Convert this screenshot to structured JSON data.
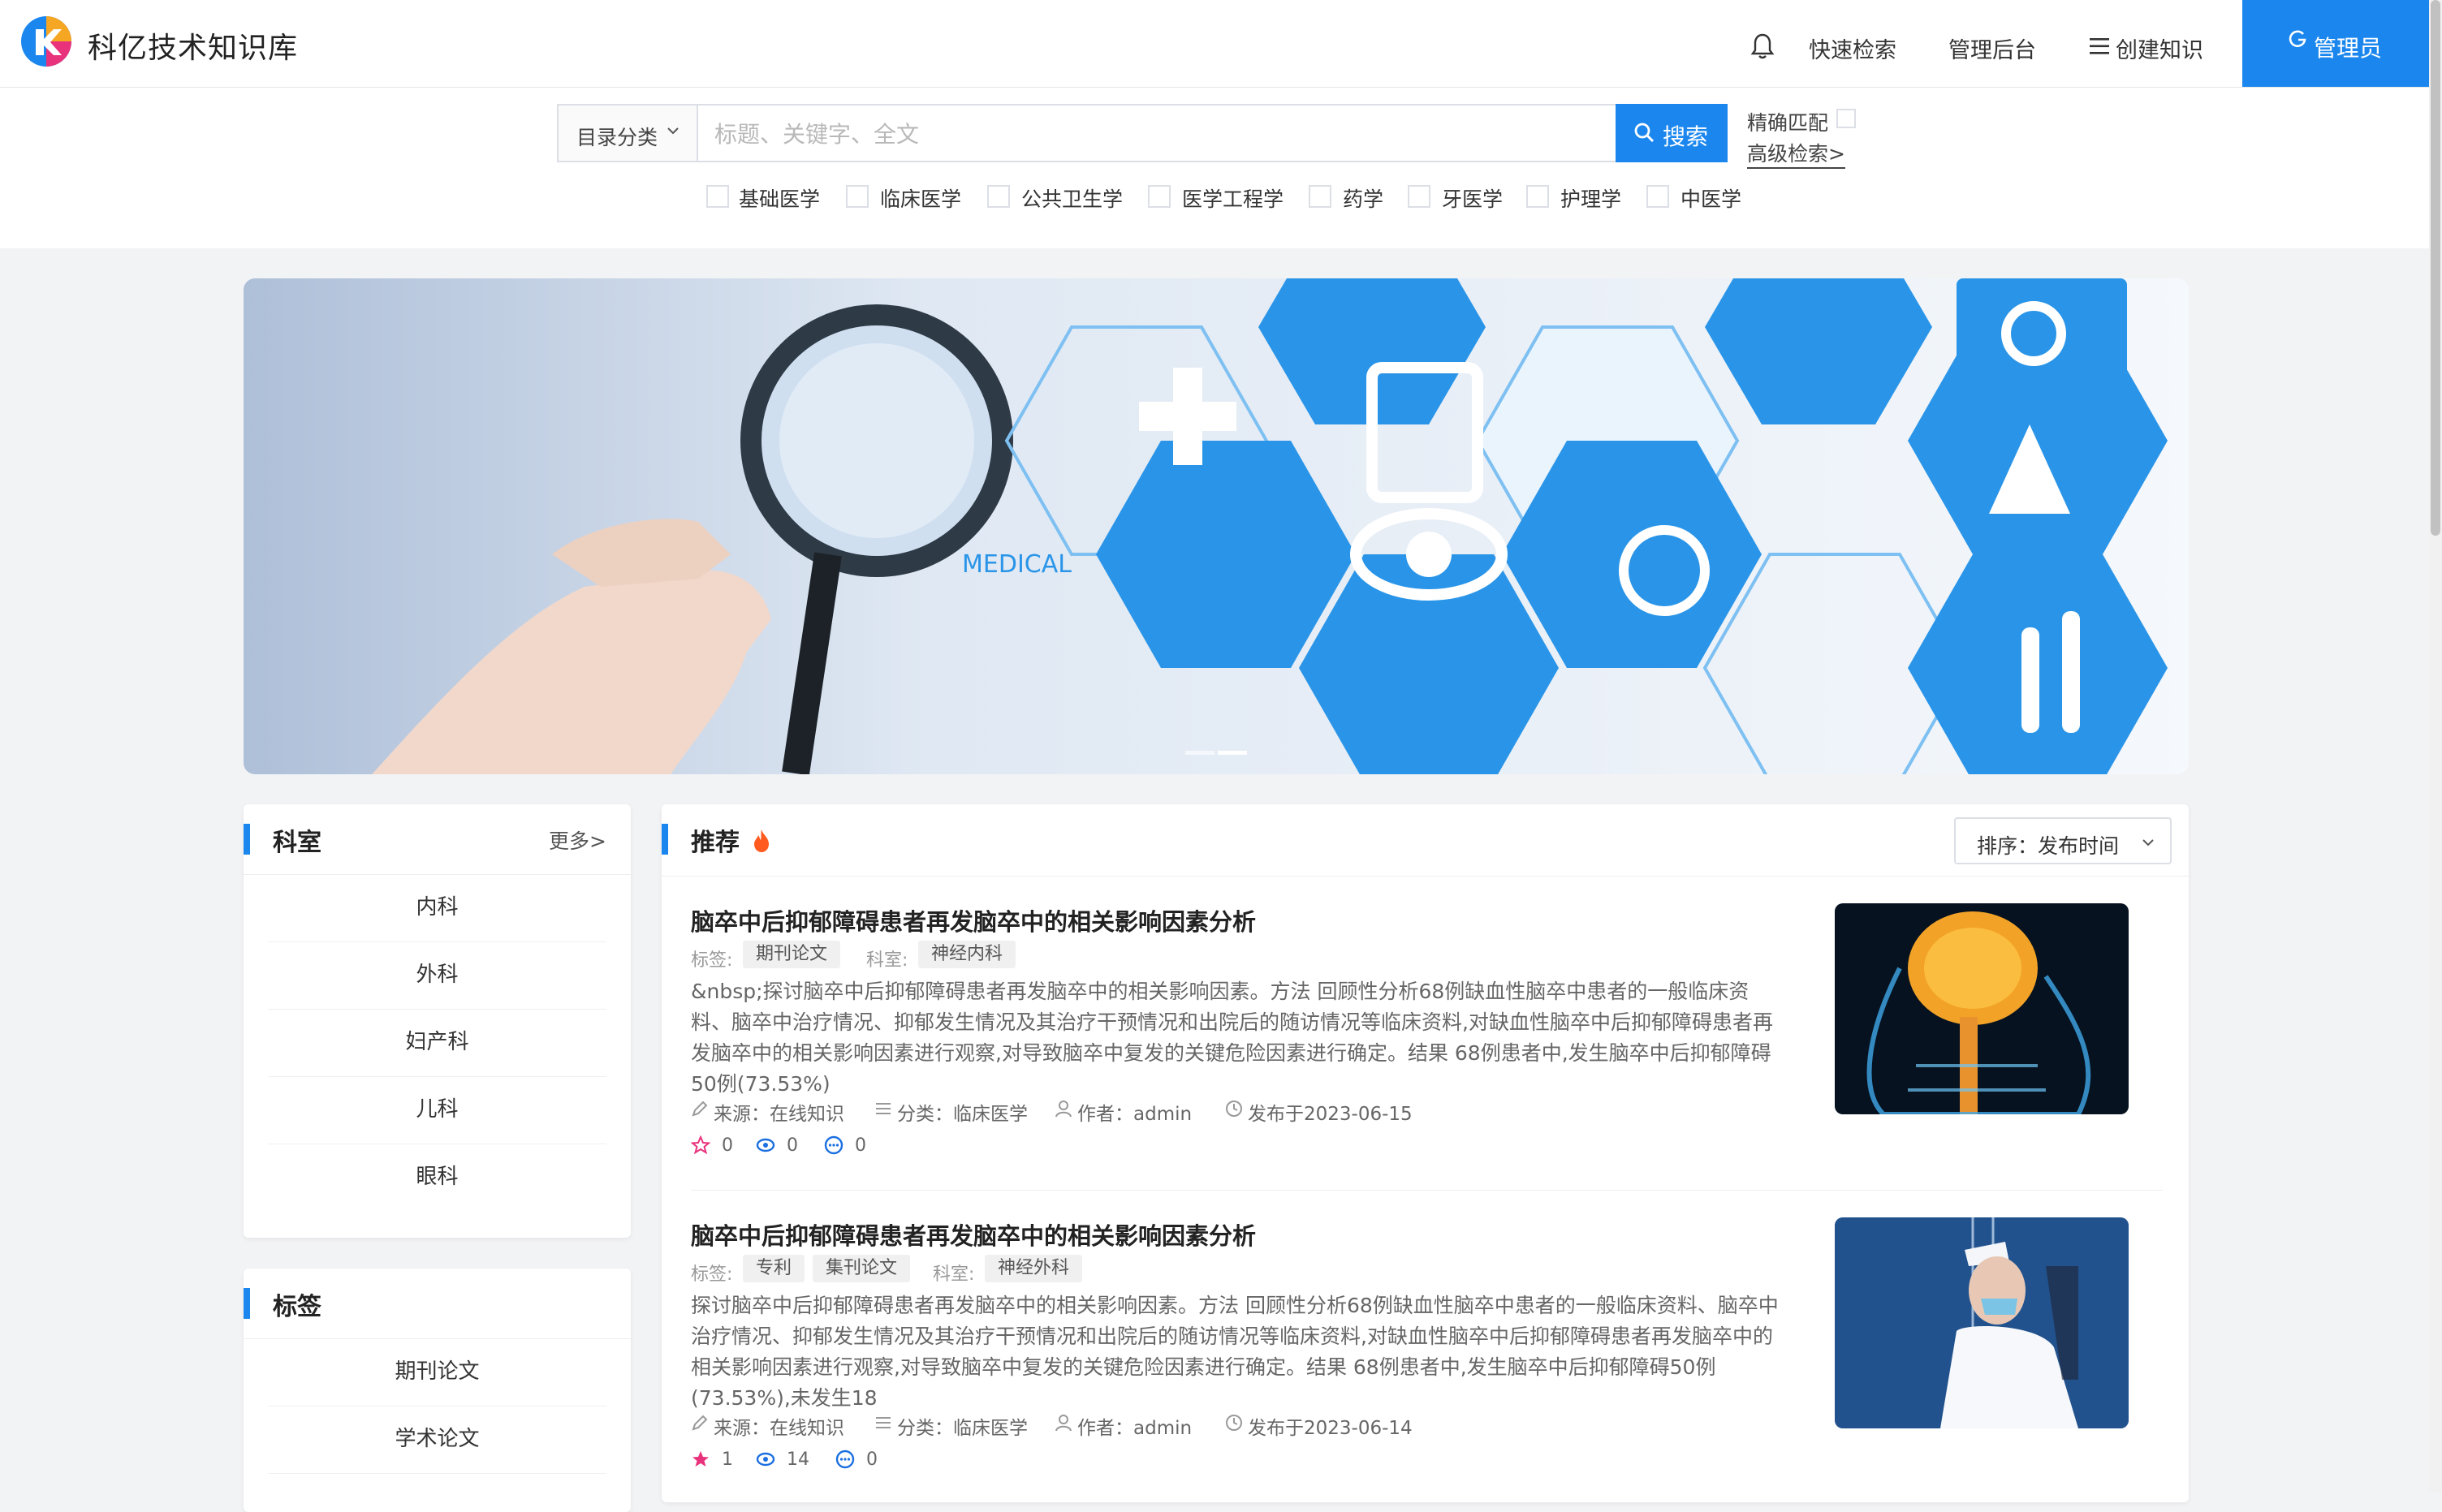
{
  "app": {
    "title": "科亿技术知识库"
  },
  "nav": {
    "quick_search": "快速检索",
    "admin_backend": "管理后台",
    "create_knowledge": "创建知识",
    "user": "管理员"
  },
  "search": {
    "category_label": "目录分类",
    "placeholder": "标题、关键字、全文",
    "button": "搜索",
    "exact_match": "精确匹配",
    "advanced": "高级检索>",
    "filters": [
      "基础医学",
      "临床医学",
      "公共卫生学",
      "医学工程学",
      "药学",
      "牙医学",
      "护理学",
      "中医学"
    ]
  },
  "banner": {
    "texts": [
      "MEDICAL",
      "MEDICAL"
    ]
  },
  "departments": {
    "title": "科室",
    "more": "更多>",
    "items": [
      "内科",
      "外科",
      "妇产科",
      "儿科",
      "眼科"
    ]
  },
  "tags": {
    "title": "标签",
    "items": [
      "期刊论文",
      "学术论文"
    ]
  },
  "recommend": {
    "title": "推荐",
    "sort": "排序：发布时间",
    "articles": [
      {
        "title": "脑卒中后抑郁障碍患者再发脑卒中的相关影响因素分析",
        "tag_label": "标签:",
        "tags": [
          "期刊论文"
        ],
        "dept_label": "科室:",
        "dept": "神经内科",
        "abstract": "&nbsp;探讨脑卒中后抑郁障碍患者再发脑卒中的相关影响因素。方法 回顾性分析68例缺血性脑卒中患者的一般临床资料、脑卒中治疗情况、抑郁发生情况及其治疗干预情况和出院后的随访情况等临床资料,对缺血性脑卒中后抑郁障碍患者再发脑卒中的相关影响因素进行观察,对导致脑卒中复发的关键危险因素进行确定。结果 68例患者中,发生脑卒中后抑郁障碍50例(73.53%)",
        "source": "来源：在线知识",
        "category": "分类：临床医学",
        "author": "作者：admin",
        "date": "发布于2023-06-15",
        "stars": "0",
        "views": "0",
        "comments": "0",
        "starred": false
      },
      {
        "title": "脑卒中后抑郁障碍患者再发脑卒中的相关影响因素分析",
        "tag_label": "标签:",
        "tags": [
          "专利",
          "集刊论文"
        ],
        "dept_label": "科室:",
        "dept": "神经外科",
        "abstract": "探讨脑卒中后抑郁障碍患者再发脑卒中的相关影响因素。方法 回顾性分析68例缺血性脑卒中患者的一般临床资料、脑卒中治疗情况、抑郁发生情况及其治疗干预情况和出院后的随访情况等临床资料,对缺血性脑卒中后抑郁障碍患者再发脑卒中的相关影响因素进行观察,对导致脑卒中复发的关键危险因素进行确定。结果 68例患者中,发生脑卒中后抑郁障碍50例(73.53%),未发生18",
        "source": "来源：在线知识",
        "category": "分类：临床医学",
        "author": "作者：admin",
        "date": "发布于2023-06-14",
        "stars": "1",
        "views": "14",
        "comments": "0",
        "starred": true
      }
    ]
  },
  "colors": {
    "accent": "#1b87ee",
    "fire": "#ff5a1f",
    "star_active": "#e8327c"
  }
}
